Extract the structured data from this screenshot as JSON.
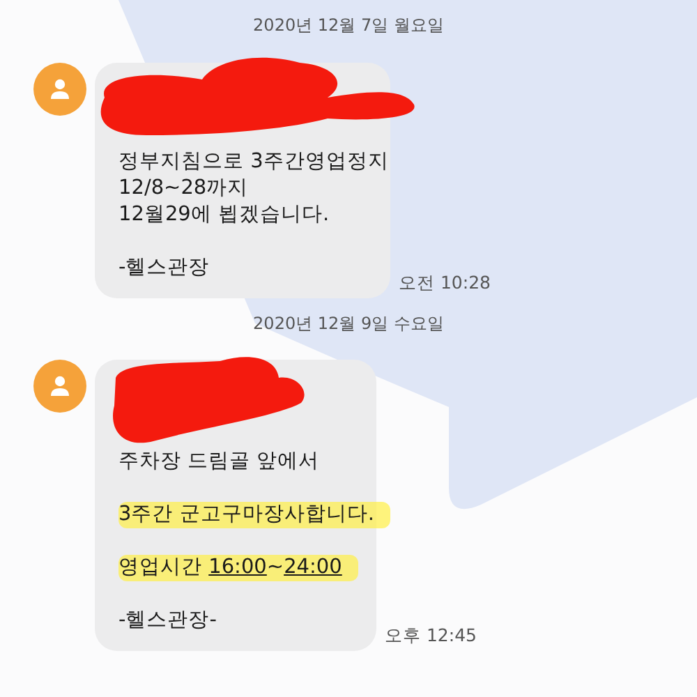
{
  "messages": [
    {
      "date": "2020년 12월 7일 월요일",
      "redacted": true,
      "time": "오전 10:28",
      "paragraphs": [
        {
          "lines": [
            {
              "text": "정부지침으로 3주간영업정지",
              "highlighted": false
            },
            {
              "text": "12/8~28까지",
              "highlighted": false
            },
            {
              "text": "12월29에 뵙겠습니다.",
              "highlighted": false
            }
          ]
        },
        {
          "lines": [
            {
              "text": "-헬스관장",
              "highlighted": false
            }
          ]
        }
      ]
    },
    {
      "date": "2020년 12월 9일 수요일",
      "redacted": true,
      "time": "오후 12:45",
      "paragraphs": [
        {
          "lines": [
            {
              "text": "주차장 드림골 앞에서",
              "highlighted": false
            }
          ]
        },
        {
          "lines": [
            {
              "text": "3주간 군고구마장사합니다.",
              "highlighted": true
            }
          ]
        },
        {
          "lines": [
            {
              "highlighted": true,
              "parts": [
                {
                  "kind": "plain",
                  "text": "영업시간 "
                },
                {
                  "kind": "link",
                  "text": "16:00"
                },
                {
                  "kind": "plain",
                  "text": "~"
                },
                {
                  "kind": "link",
                  "text": "24:00"
                }
              ]
            }
          ]
        },
        {
          "lines": [
            {
              "text": "-헬스관장-",
              "highlighted": false
            }
          ]
        }
      ]
    }
  ]
}
